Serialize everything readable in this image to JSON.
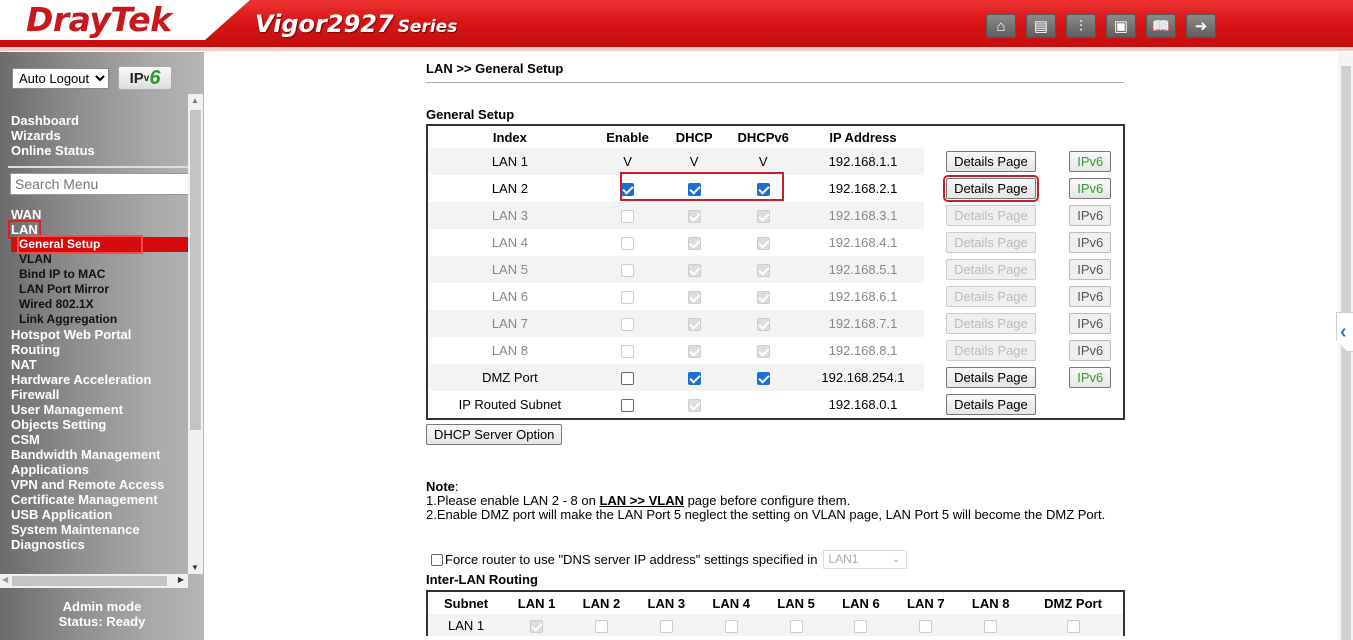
{
  "header": {
    "brand": "DrayTek",
    "model": "Vigor2927",
    "series": "Series",
    "toolbar": [
      {
        "name": "home-icon",
        "glyph": "⌂"
      },
      {
        "name": "quick-start-icon",
        "glyph": "▤"
      },
      {
        "name": "settings-sliders-icon",
        "glyph": "⫶"
      },
      {
        "name": "save-icon",
        "glyph": "▣"
      },
      {
        "name": "manual-book-icon",
        "glyph": "📖"
      },
      {
        "name": "logout-icon",
        "glyph": "➜"
      }
    ]
  },
  "sidebar": {
    "auto_logout": "Auto Logout",
    "ipv6_ip": "IP",
    "ipv6_v": "v",
    "ipv6_six": "6",
    "top_links": [
      "Dashboard",
      "Wizards",
      "Online Status"
    ],
    "search_placeholder": "Search Menu",
    "wan": "WAN",
    "lan": "LAN",
    "lan_sub": [
      "General Setup",
      "VLAN",
      "Bind IP to MAC",
      "LAN Port Mirror",
      "Wired 802.1X",
      "Link Aggregation"
    ],
    "menu": [
      "Hotspot Web Portal",
      "Routing",
      "NAT",
      "Hardware Acceleration",
      "Firewall",
      "User Management",
      "Objects Setting",
      "CSM",
      "Bandwidth Management",
      "Applications",
      "VPN and Remote Access",
      "Certificate Management",
      "USB Application",
      "System Maintenance",
      "Diagnostics"
    ],
    "status_mode": "Admin mode",
    "status_text": "Status: Ready"
  },
  "main": {
    "breadcrumb": "LAN >> General Setup",
    "section_title": "General Setup",
    "columns": [
      "Index",
      "Enable",
      "DHCP",
      "DHCPv6",
      "IP Address",
      "",
      ""
    ],
    "details_label": "Details Page",
    "ipv6_label": "IPv6",
    "rows": [
      {
        "index": "LAN 1",
        "enable": "V",
        "dhcp": "V",
        "dhcpv6": "V",
        "ip": "192.168.1.1",
        "state": "fixed",
        "ipv6": true
      },
      {
        "index": "LAN 2",
        "enable": true,
        "dhcp": true,
        "dhcpv6": true,
        "ip": "192.168.2.1",
        "state": "active",
        "ipv6": true
      },
      {
        "index": "LAN 3",
        "enable": false,
        "dhcp": true,
        "dhcpv6": true,
        "ip": "192.168.3.1",
        "state": "disabled",
        "ipv6": true
      },
      {
        "index": "LAN 4",
        "enable": false,
        "dhcp": true,
        "dhcpv6": true,
        "ip": "192.168.4.1",
        "state": "disabled",
        "ipv6": true
      },
      {
        "index": "LAN 5",
        "enable": false,
        "dhcp": true,
        "dhcpv6": true,
        "ip": "192.168.5.1",
        "state": "disabled",
        "ipv6": true
      },
      {
        "index": "LAN 6",
        "enable": false,
        "dhcp": true,
        "dhcpv6": true,
        "ip": "192.168.6.1",
        "state": "disabled",
        "ipv6": true
      },
      {
        "index": "LAN 7",
        "enable": false,
        "dhcp": true,
        "dhcpv6": true,
        "ip": "192.168.7.1",
        "state": "disabled",
        "ipv6": true
      },
      {
        "index": "LAN 8",
        "enable": false,
        "dhcp": true,
        "dhcpv6": true,
        "ip": "192.168.8.1",
        "state": "disabled",
        "ipv6": true
      },
      {
        "index": "DMZ Port",
        "enable": false,
        "dhcp": true,
        "dhcpv6": true,
        "ip": "192.168.254.1",
        "state": "dmz",
        "ipv6": true
      },
      {
        "index": "IP Routed Subnet",
        "enable": false,
        "dhcp": true,
        "dhcpv6": null,
        "ip": "192.168.0.1",
        "state": "routed",
        "ipv6": false
      }
    ],
    "dhcp_server_option": "DHCP Server Option",
    "note_title": "Note",
    "note_1_pre": "1.Please enable LAN 2 - 8 on ",
    "note_1_link": "LAN >> VLAN",
    "note_1_post": " page before configure them.",
    "note_2": "2.Enable DMZ port will make the LAN Port 5 neglect the setting on VLAN page, LAN Port 5 will become the DMZ Port.",
    "force_dns_label": "Force router to use \"DNS server IP address\" settings specified in",
    "force_dns_select": "LAN1",
    "inter_lan_title": "Inter-LAN Routing",
    "inter_lan_columns": [
      "Subnet",
      "LAN 1",
      "LAN 2",
      "LAN 3",
      "LAN 4",
      "LAN 5",
      "LAN 6",
      "LAN 7",
      "LAN 8",
      "DMZ Port"
    ],
    "inter_lan_rows": [
      {
        "subnet": "LAN 1",
        "values": [
          true,
          false,
          false,
          false,
          false,
          false,
          false,
          false,
          false
        ]
      }
    ]
  },
  "colors": {
    "brand_red": "#d81616",
    "highlight": "#c0222b",
    "checkbox_blue": "#1a6fd6",
    "ipv6_green": "#2f9a2f"
  }
}
